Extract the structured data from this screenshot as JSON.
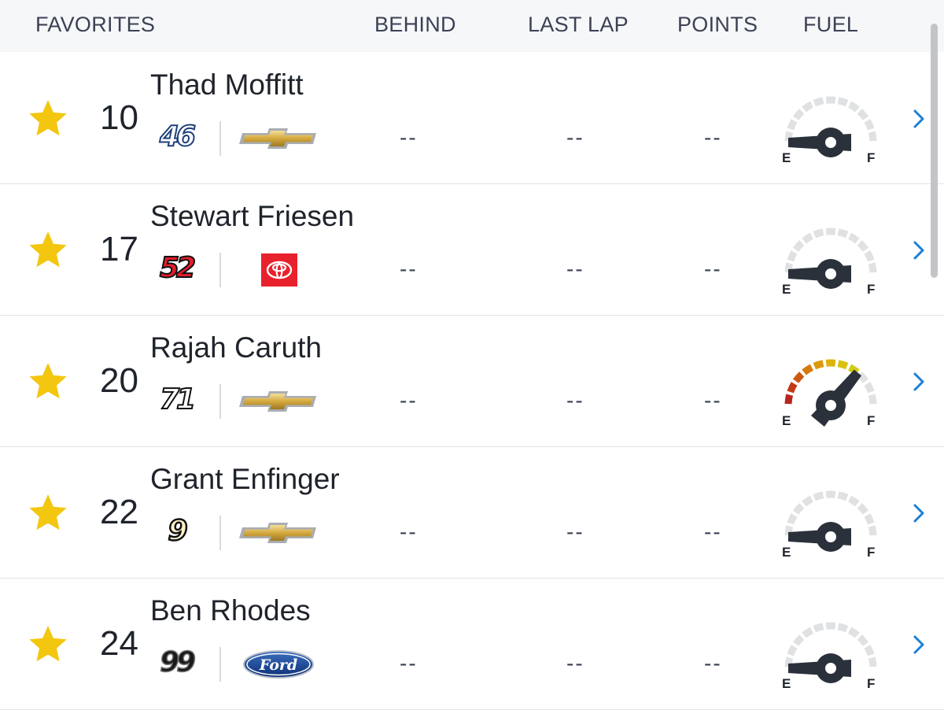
{
  "header": {
    "favorites": "FAVORITES",
    "behind": "BEHIND",
    "last_lap": "LAST LAP",
    "points": "POINTS",
    "fuel": "FUEL"
  },
  "colors": {
    "star": "#f3c60f",
    "text": "#1f232b",
    "chevron": "#1a7fd8",
    "gauge_inactive": "#dfe1e3",
    "gauge_needle": "#2b313b"
  },
  "drivers": [
    {
      "position": "10",
      "name": "Thad Moffitt",
      "car_number": "46",
      "manufacturer": "chevrolet-logo",
      "behind": "--",
      "last_lap": "--",
      "points": "--",
      "fuel_level": 0,
      "favorite": true
    },
    {
      "position": "17",
      "name": "Stewart Friesen",
      "car_number": "52",
      "manufacturer": "toyota-logo",
      "behind": "--",
      "last_lap": "--",
      "points": "--",
      "fuel_level": 0,
      "favorite": true
    },
    {
      "position": "20",
      "name": "Rajah Caruth",
      "car_number": "71",
      "manufacturer": "chevrolet-logo",
      "behind": "--",
      "last_lap": "--",
      "points": "--",
      "fuel_level": 0.72,
      "favorite": true
    },
    {
      "position": "22",
      "name": "Grant Enfinger",
      "car_number": "9",
      "manufacturer": "chevrolet-logo",
      "behind": "--",
      "last_lap": "--",
      "points": "--",
      "fuel_level": 0,
      "favorite": true
    },
    {
      "position": "24",
      "name": "Ben Rhodes",
      "car_number": "99",
      "manufacturer": "ford-logo",
      "behind": "--",
      "last_lap": "--",
      "points": "--",
      "fuel_level": 0,
      "favorite": true
    }
  ],
  "icons": {
    "star": "star-icon",
    "chevron": "chevron-right-icon",
    "gauge": "fuel-gauge-icon"
  },
  "gauge_labels": {
    "empty": "E",
    "full": "F"
  }
}
